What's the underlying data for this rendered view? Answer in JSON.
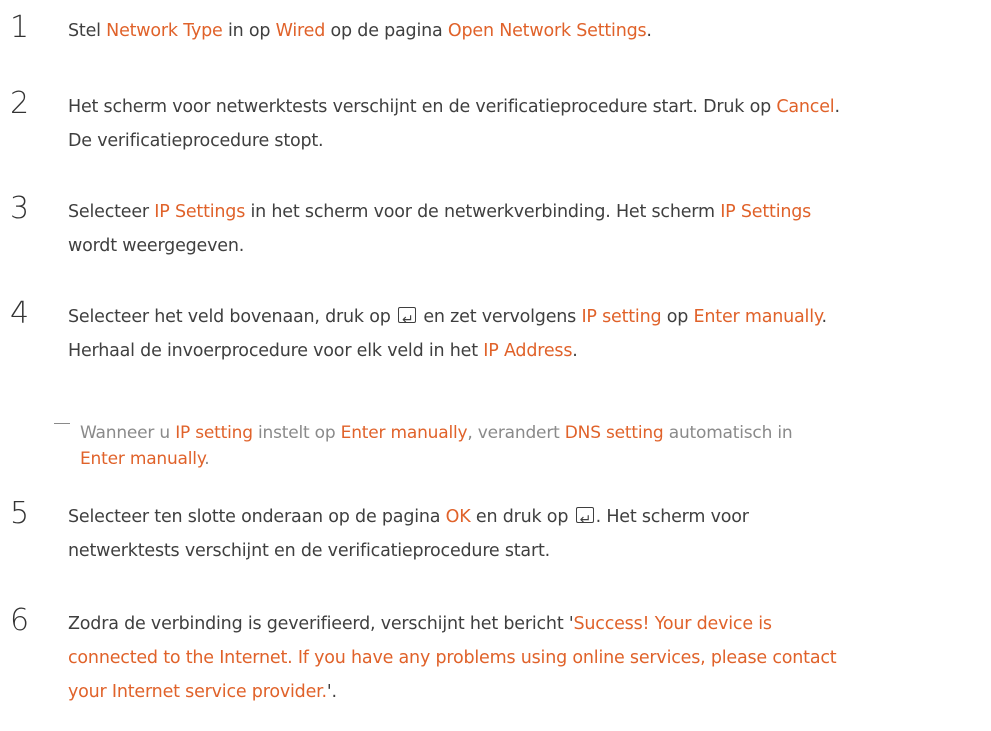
{
  "steps": [
    {
      "number": "1",
      "parts": [
        "Stel ",
        "Network Type",
        " in op ",
        "Wired",
        " op de pagina ",
        "Open Network Settings",
        "."
      ]
    },
    {
      "number": "2",
      "line1": [
        "Het scherm voor netwerktests verschijnt en de verificatieprocedure start. Druk op ",
        "Cancel",
        "."
      ],
      "line2": "De verificatieprocedure stopt."
    },
    {
      "number": "3",
      "line1": [
        "Selecteer ",
        "IP Settings",
        " in het scherm voor de netwerkverbinding. Het scherm ",
        "IP Settings"
      ],
      "line2": "wordt weergegeven."
    },
    {
      "number": "4",
      "line1": [
        "Selecteer het veld bovenaan, druk op ",
        " en zet vervolgens ",
        "IP setting",
        " op ",
        "Enter manually",
        "."
      ],
      "line2": [
        "Herhaal de invoerprocedure voor elk veld in het ",
        "IP Address",
        "."
      ],
      "note": [
        "Wanneer u ",
        "IP setting",
        " instelt op ",
        "Enter manually",
        ", verandert ",
        "DNS setting",
        " automatisch in ",
        "Enter manually",
        "."
      ]
    },
    {
      "number": "5",
      "line1": [
        "Selecteer ten slotte onderaan op de pagina ",
        "OK",
        " en druk op ",
        ". Het scherm voor"
      ],
      "line2": "netwerktests verschijnt en de verificatieprocedure start."
    },
    {
      "number": "6",
      "line1": [
        "Zodra de verbinding is geverifieerd, verschijnt het bericht '",
        "Success! Your device is"
      ],
      "line2": "connected to the Internet. If you have any problems using online services, please contact",
      "line3": [
        "your Internet service provider.",
        "'."
      ]
    }
  ],
  "icons": {
    "enter": "enter-key-icon"
  },
  "colors": {
    "highlight": "#e0622a",
    "text": "#3f3f3f",
    "note": "#8a8a8a"
  }
}
